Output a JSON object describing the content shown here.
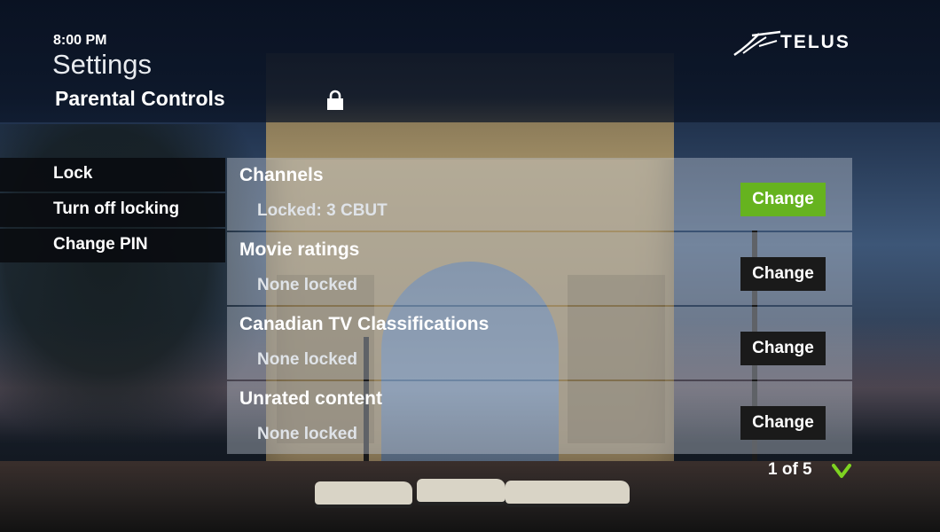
{
  "header": {
    "time": "8:00 PM",
    "title": "Settings",
    "subtitle": "Parental Controls",
    "lock_icon": "padlock-icon",
    "brand": "TELUS"
  },
  "menu": {
    "items": [
      {
        "label": "Lock"
      },
      {
        "label": "Turn off locking"
      },
      {
        "label": "Change PIN"
      }
    ]
  },
  "panel": {
    "rows": [
      {
        "title": "Channels",
        "status": "Locked: 3 CBUT",
        "button": "Change",
        "focused": true
      },
      {
        "title": "Movie ratings",
        "status": "None locked",
        "button": "Change",
        "focused": false
      },
      {
        "title": "Canadian TV Classifications",
        "status": "None locked",
        "button": "Change",
        "focused": false
      },
      {
        "title": "Unrated content",
        "status": "None locked",
        "button": "Change",
        "focused": false
      }
    ]
  },
  "pager": {
    "text": "1 of 5",
    "icon": "chevron-down-icon"
  },
  "colors": {
    "focus_green": "#66b31f",
    "button_dark": "#1a1a1a",
    "menu_bg": "#0a0c10"
  }
}
